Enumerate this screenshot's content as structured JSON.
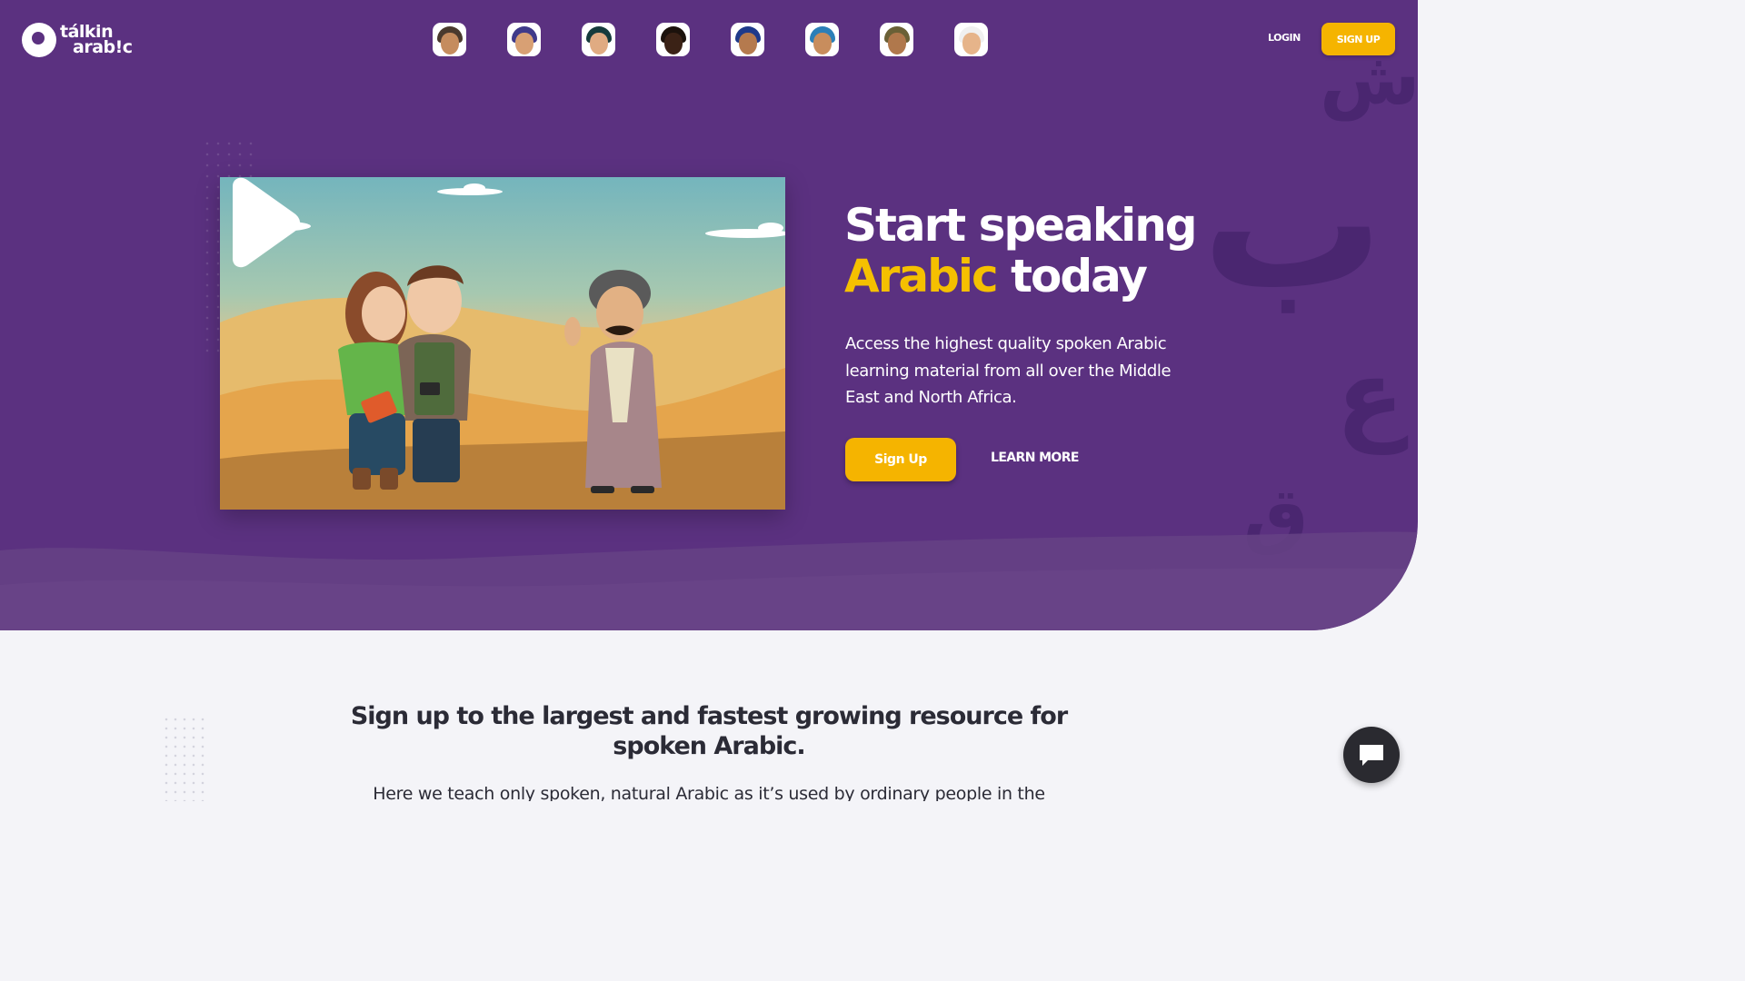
{
  "brand": {
    "logo_line1": "tálkin",
    "logo_line2": "arab!c"
  },
  "nav": {
    "avatars": [
      {
        "name": "man-cap",
        "skin": "#c58c5e",
        "hair": "#4a3a2e"
      },
      {
        "name": "woman-hijab-purple",
        "skin": "#d8a074",
        "hair": "#3f3a8a"
      },
      {
        "name": "woman-hijab-dark",
        "skin": "#e0ab82",
        "hair": "#163b3c"
      },
      {
        "name": "man-dark",
        "skin": "#3b2216",
        "hair": "#1c120c"
      },
      {
        "name": "woman-hijab-blue",
        "skin": "#b57a4e",
        "hair": "#1f3a8a"
      },
      {
        "name": "man-blue-turban",
        "skin": "#c88d5d",
        "hair": "#2c7fb8"
      },
      {
        "name": "woman-hijab-olive",
        "skin": "#b0784c",
        "hair": "#6a6036"
      },
      {
        "name": "man-keffiyeh",
        "skin": "#e6b48a",
        "hair": "#f0f0f0"
      }
    ],
    "login_label": "LOGIN",
    "signup_label": "SIGN UP"
  },
  "colors": {
    "hero_bg": "#5b3180",
    "accent": "#f5b400",
    "text_dark": "#2b2b36"
  },
  "hero": {
    "title_line1": "Start speaking",
    "title_accent": "Arabic",
    "title_rest": "today",
    "description": "Access the highest quality spoken Arabic learning material from all over the Middle East and North Africa.",
    "signup_label": "Sign Up",
    "learn_more_label": "LEARN MORE",
    "video_icon": "play-icon"
  },
  "decor": {
    "glyph_1": "ش",
    "glyph_2": "ب",
    "glyph_3": "ع",
    "glyph_4": "ق"
  },
  "section": {
    "title": "Sign up to the largest and fastest growing resource for spoken Arabic.",
    "text": "Here we teach only spoken, natural Arabic as it’s used by ordinary people in the"
  },
  "chat": {
    "icon": "chat-icon"
  }
}
